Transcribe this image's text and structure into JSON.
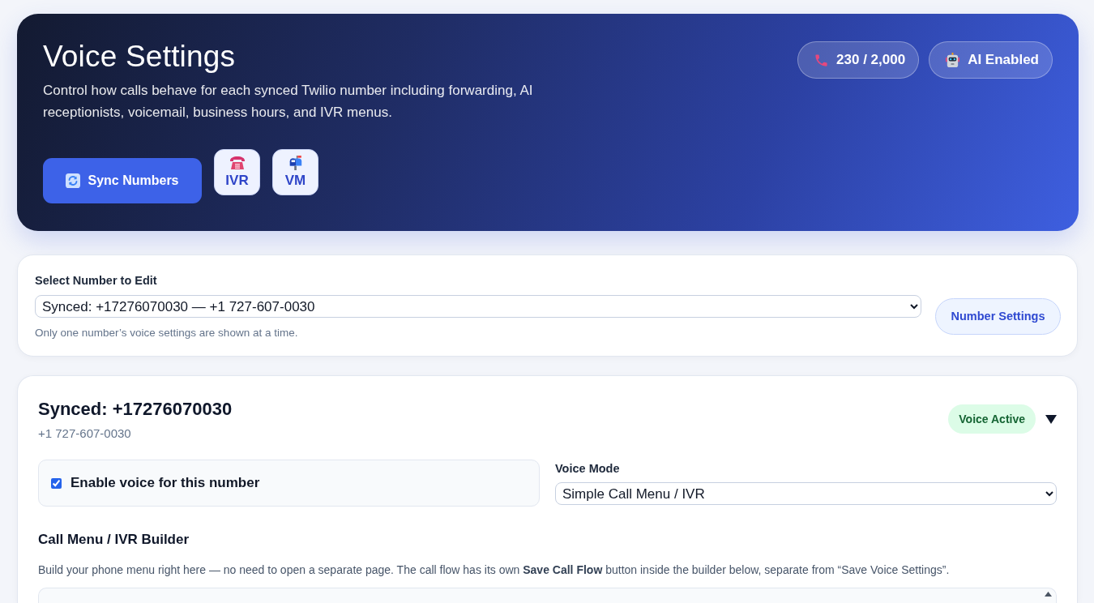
{
  "header": {
    "title": "Voice Settings",
    "description": "Control how calls behave for each synced Twilio number including forwarding, AI receptionists, voicemail, business hours, and IVR menus.",
    "usage_pill": "230 / 2,000",
    "ai_pill": "AI Enabled",
    "actions": [
      {
        "kind": "primary",
        "label": "Sync Numbers"
      },
      {
        "kind": "tile",
        "label": "IVR"
      },
      {
        "kind": "tile",
        "label": "VM"
      }
    ]
  },
  "number_picker": {
    "label": "Select Number to Edit",
    "value": "Synced: +17276070030 — +1 727-607-0030",
    "hint": "Only one number’s voice settings are shown at a time.",
    "button": "Number Settings"
  },
  "number_card": {
    "title": "Synced: +17276070030",
    "subtitle": "+1 727-607-0030",
    "status_badge": "Voice Active",
    "expanded": true,
    "enable_voice": {
      "label": "Enable voice for this number",
      "checked": true
    },
    "voice_mode": {
      "label": "Voice Mode",
      "value": "Simple Call Menu / IVR"
    },
    "ivr_builder": {
      "title": "Call Menu / IVR Builder",
      "description": "Build your phone menu right here — no need to open a separate page. The call flow has its own **Save Call Flow** button inside the builder below, separate from “Save Voice Settings”."
    }
  }
}
